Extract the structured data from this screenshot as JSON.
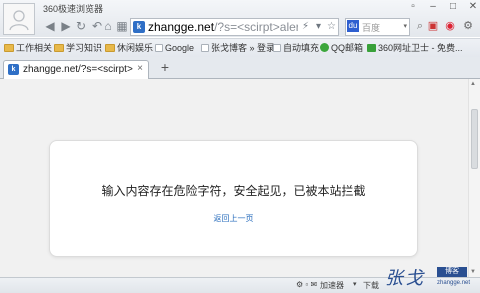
{
  "window": {
    "title": "360极速浏览器"
  },
  "nav": {
    "url_domain": "zhangge.net",
    "url_rest": "/?s=<scirpt>alert",
    "search_text": "百度"
  },
  "bookmarks": [
    {
      "label": "工作相关",
      "icon": "folder-icon"
    },
    {
      "label": "学习知识",
      "icon": "folder-icon"
    },
    {
      "label": "休闲娱乐",
      "icon": "folder-icon"
    },
    {
      "label": "Google",
      "icon": "page-icon"
    },
    {
      "label": "张戈博客 » 登录",
      "icon": "page-icon"
    },
    {
      "label": "自动填充",
      "icon": "page-icon"
    },
    {
      "label": "QQ邮箱",
      "icon": "qqmail-icon"
    },
    {
      "label": "360网址卫士 - 免费...",
      "icon": "shield-icon"
    }
  ],
  "tab": {
    "label": "zhangge.net/?s=<scirpt>ale",
    "close": "×",
    "newtab": "+"
  },
  "page": {
    "message": "输入内容存在危险字符，安全起见，已被本站拦截",
    "back_link": "返回上一页"
  },
  "status": {
    "accelerator": "加速器",
    "download": "下载",
    "watermark_sig": "张戈",
    "watermark_seal": "博客",
    "watermark_url": "zhangge.net"
  },
  "colors": {
    "link": "#2a6ebd",
    "page_bg": "#f1f1f1",
    "card_bg": "#ffffff"
  }
}
